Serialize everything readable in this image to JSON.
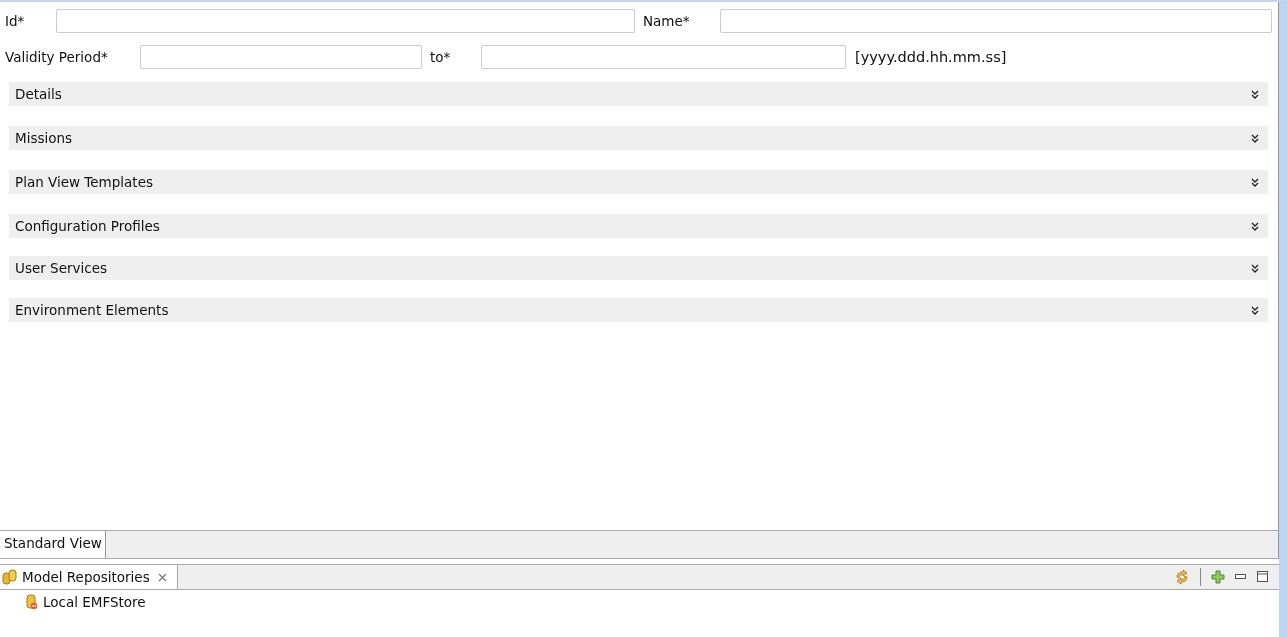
{
  "form": {
    "id_label": "Id*",
    "name_label": "Name*",
    "validity_label": "Validity Period*",
    "to_label": "to*",
    "format_hint": "[yyyy.ddd.hh.mm.ss]"
  },
  "sections": [
    {
      "title": "Details",
      "expanded": false
    },
    {
      "title": "Missions",
      "expanded": false
    },
    {
      "title": "Plan View Templates",
      "expanded": false
    },
    {
      "title": "Configuration Profiles",
      "expanded": false
    },
    {
      "title": "User Services",
      "expanded": false
    },
    {
      "title": "Environment Elements",
      "expanded": false
    }
  ],
  "editor_tabs": [
    {
      "label": "Standard View",
      "selected": true
    }
  ],
  "view": {
    "title": "Model Repositories",
    "items": [
      {
        "label": "Local EMFStore"
      }
    ]
  }
}
